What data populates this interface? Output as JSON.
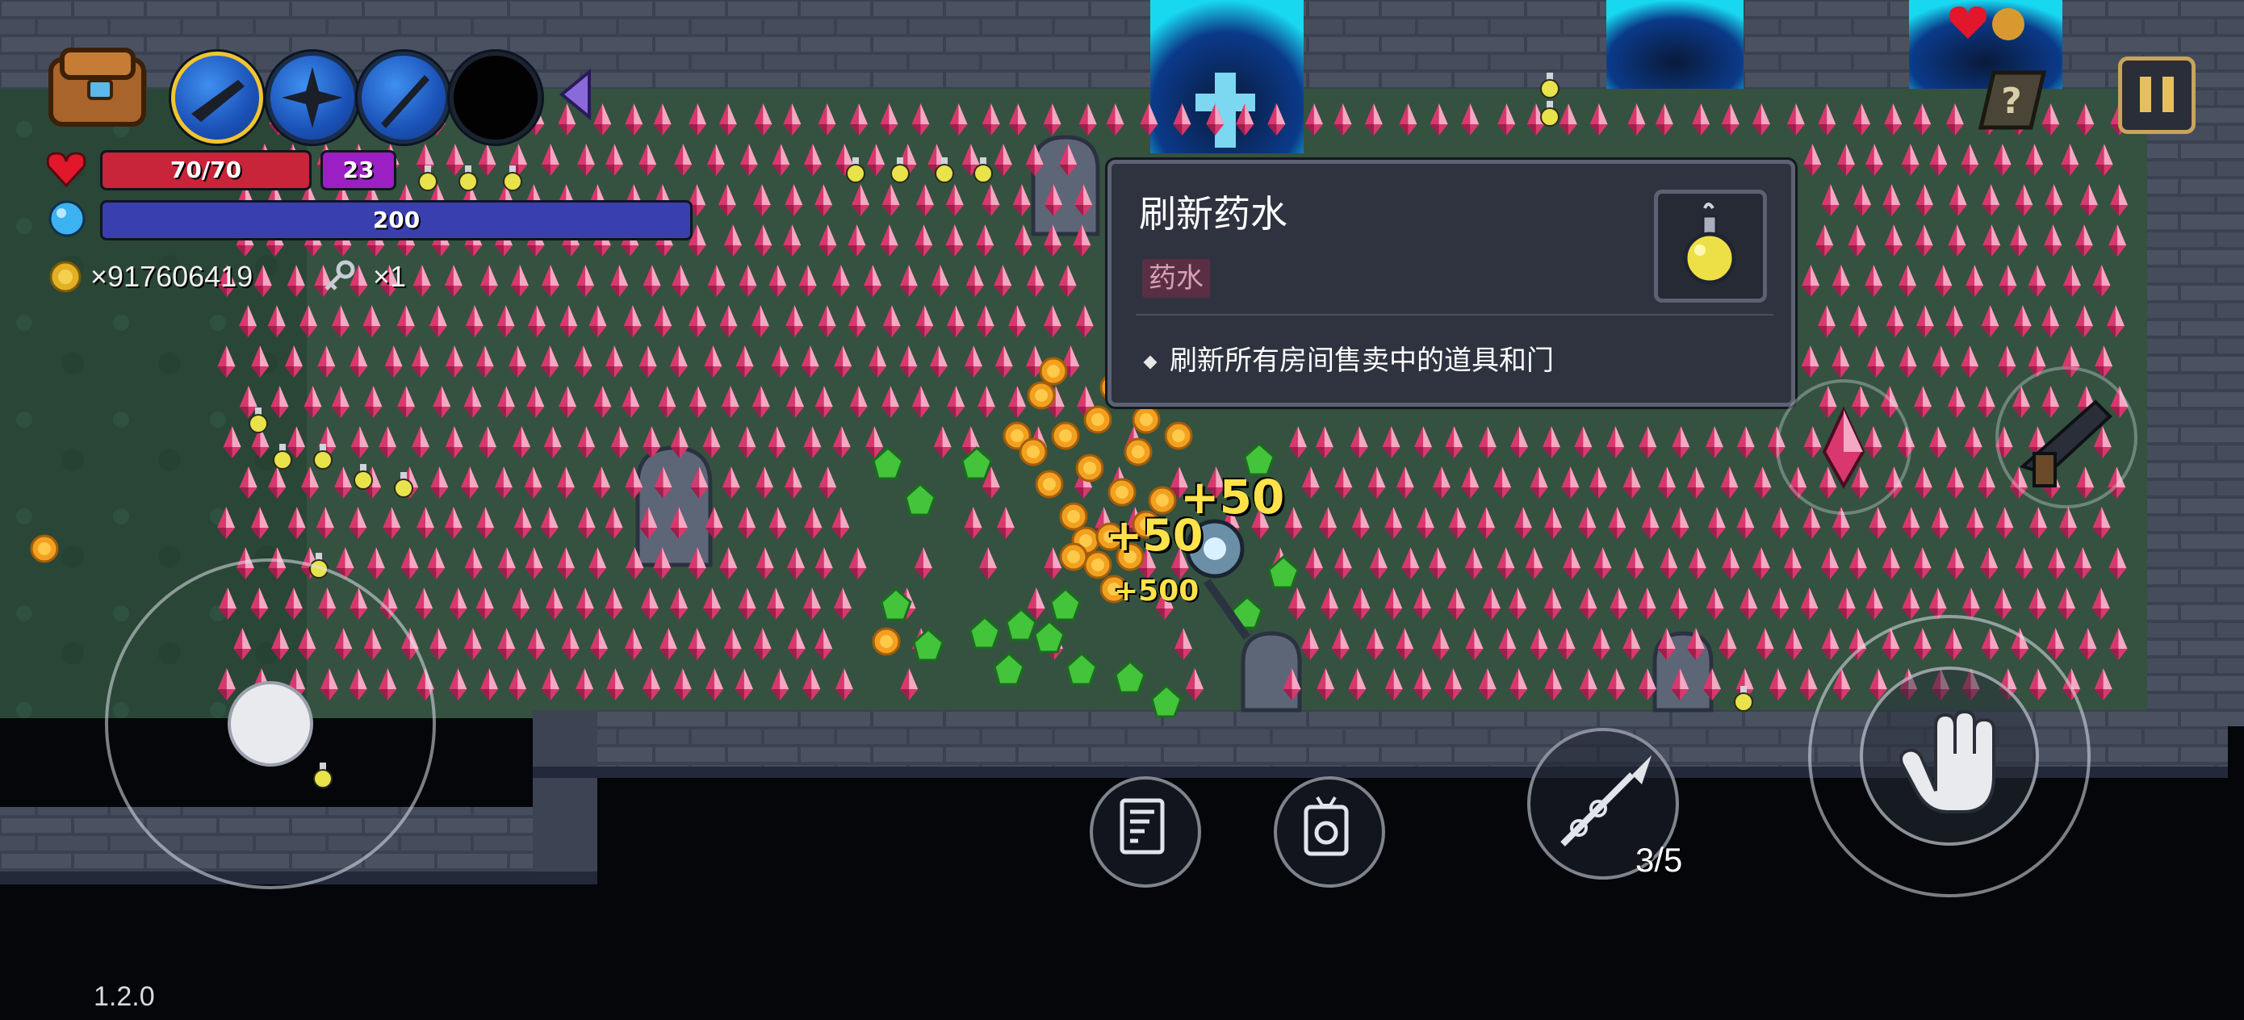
{
  "colors": {
    "hp": "#c8243a",
    "armor": "#9c1fc4",
    "mana": "#3a3fb0",
    "tooltip_bg": "#2f3340",
    "tooltip_tag_bg": "#5a2f44",
    "tooltip_tag_fg": "#d7a0b4",
    "grass": "#2c4a3a",
    "gold_text": "#ffe24a"
  },
  "hud": {
    "hp_text": "70/70",
    "armor_text": "23",
    "mana_text": "200",
    "coins_text": "×917606419",
    "keys_text": "×1",
    "hp_fill": 1.0,
    "mana_fill": 1.0
  },
  "tooltip": {
    "title": "刷新药水",
    "tag": "药水",
    "description": "刷新所有房间售卖中的道具和门"
  },
  "floating_text": {
    "big": "+50",
    "mid": "+50",
    "small": "+500"
  },
  "ammo_text": "3/5",
  "version": "1.2.0",
  "icons": {
    "bag": "backpack-icon",
    "pause": "pause-icon",
    "help": "question-icon",
    "cross": "holy-cross-icon"
  }
}
